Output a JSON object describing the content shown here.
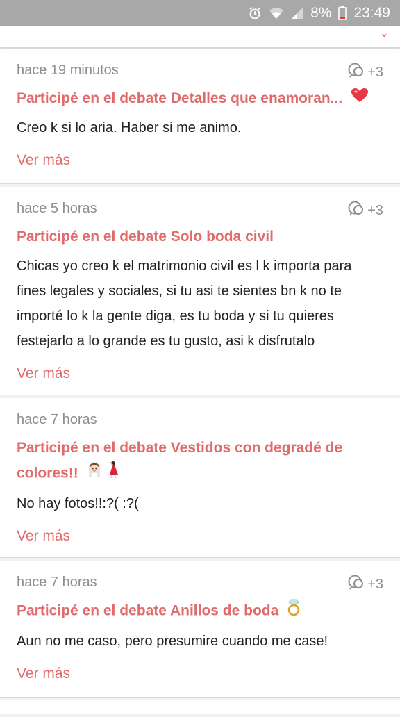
{
  "status_bar": {
    "battery": "8%",
    "time": "23:49",
    "icons": [
      "alarm-icon",
      "wifi-icon",
      "signal-icon",
      "battery-icon"
    ]
  },
  "colors": {
    "accent": "#e06b6b",
    "status_bg": "#a8a8a8"
  },
  "feed": [
    {
      "time": "hace 19 minutos",
      "comment_count": "+3",
      "title": "Participé en el debate Detalles que enamoran...",
      "title_emoji": "heart-icon",
      "body": "Creo k si lo aria. Haber si me animo.",
      "more": "Ver más"
    },
    {
      "time": "hace 5 horas",
      "comment_count": "+3",
      "title": "Participé en el debate Solo boda civil",
      "body": "Chicas yo creo k el matrimonio civil es l k importa para fines legales y sociales, si tu asi te sientes bn k no te importé lo k la gente diga, es tu boda y si tu quieres festejarlo a lo grande es tu gusto, asi k disfrutalo",
      "more": "Ver más"
    },
    {
      "time": "hace 7 horas",
      "title": "Participé en el debate Vestidos con degradé de colores!!",
      "title_emoji": "bride-dancer-icons",
      "body": "No hay fotos!!:?( :?(",
      "more": "Ver más"
    },
    {
      "time": "hace 7 horas",
      "comment_count": "+3",
      "title": "Participé en el debate Anillos de boda",
      "title_emoji": "ring-icon",
      "body": "Aun no me caso, pero presumire cuando me case!",
      "more": "Ver más"
    }
  ]
}
